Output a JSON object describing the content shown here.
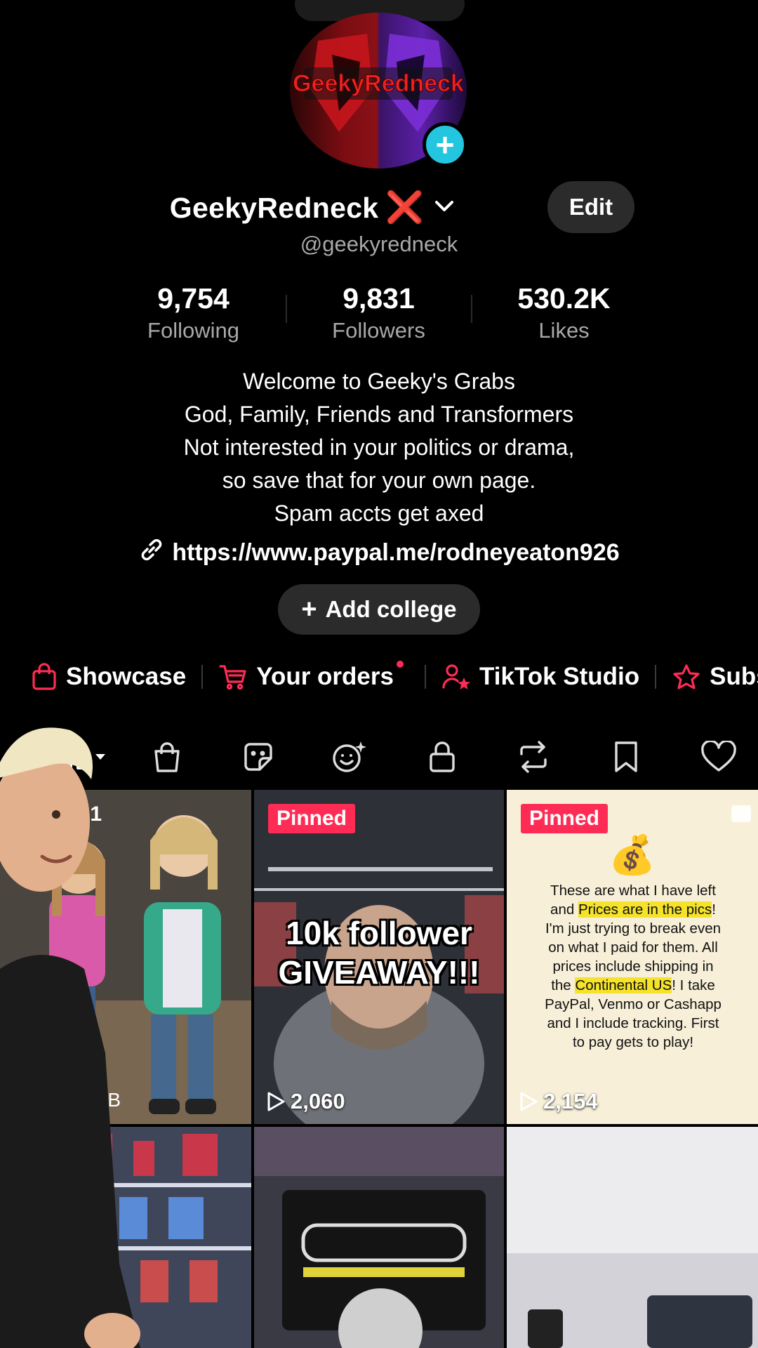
{
  "profile": {
    "display_name": "GeekyRedneck",
    "name_emoji": "❌",
    "avatar_text": "GeekyRedneck",
    "username": "@geekyredneck",
    "edit_label": "Edit"
  },
  "stats": [
    {
      "value": "9,754",
      "label": "Following"
    },
    {
      "value": "9,831",
      "label": "Followers"
    },
    {
      "value": "530.2K",
      "label": "Likes"
    }
  ],
  "bio": {
    "lines": [
      "Welcome to Geeky's Grabs",
      "God, Family, Friends and Transformers",
      "Not interested in your politics or drama,",
      "so save that for your own page.",
      "Spam accts get axed"
    ],
    "link": "https://www.paypal.me/rodneyeaton926"
  },
  "add_college_label": "Add college",
  "shortcuts": [
    "Showcase",
    "Your orders",
    "TikTok Studio",
    "Subs"
  ],
  "accent_color": "#fe2c55",
  "tabs": [
    "grid-icon",
    "shop-bag-icon",
    "sticker-icon",
    "face-sparkle-icon",
    "lock-icon",
    "repost-icon",
    "bookmark-icon",
    "heart-icon"
  ],
  "videos": [
    {
      "badge": "",
      "views": "",
      "corner_fragment": ": 1",
      "size_fragment": "MB"
    },
    {
      "badge": "Pinned",
      "overlay": "10k follower\nGIVEAWAY!!!",
      "views": "2,060"
    },
    {
      "badge": "Pinned",
      "emoji": "💰",
      "note_parts": [
        "These are what I have left and ",
        "Prices are in the pics",
        "! I'm just trying to break even on what I paid for them. All prices include shipping in the ",
        "Continental US",
        "! I take PayPal, Venmo or Cashapp and I include tracking. First to pay gets to play!"
      ],
      "views": "2,154"
    },
    {
      "badge": "",
      "views": ""
    },
    {
      "badge": "",
      "views": ""
    },
    {
      "badge": "",
      "views": ""
    }
  ]
}
